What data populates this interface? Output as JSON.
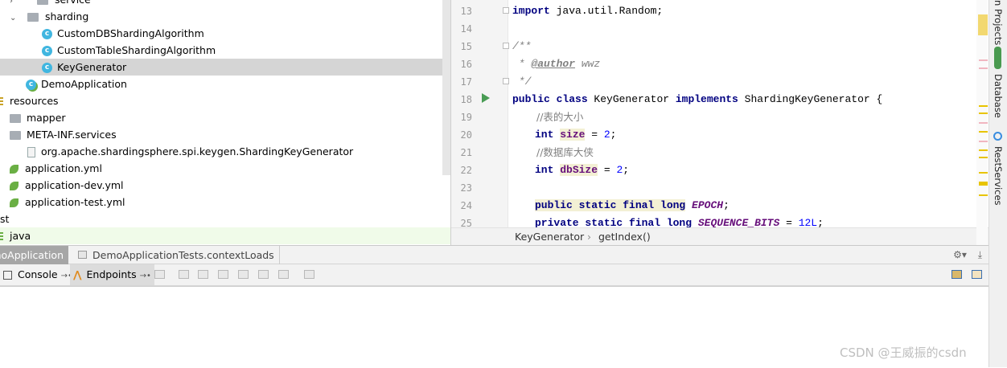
{
  "project_tree": {
    "items": [
      {
        "label": "service",
        "icon": "folder-icon"
      },
      {
        "label": "sharding",
        "icon": "folder-icon"
      },
      {
        "label": "CustomDBShardingAlgorithm",
        "icon": "class-icon"
      },
      {
        "label": "CustomTableShardingAlgorithm",
        "icon": "class-icon"
      },
      {
        "label": "KeyGenerator",
        "icon": "class-icon"
      },
      {
        "label": "DemoApplication",
        "icon": "spring-class-icon"
      },
      {
        "label": "resources",
        "icon": "resources-folder-icon"
      },
      {
        "label": "mapper",
        "icon": "folder-icon"
      },
      {
        "label": "META-INF.services",
        "icon": "folder-icon"
      },
      {
        "label": "org.apache.shardingsphere.spi.keygen.ShardingKeyGenerator",
        "icon": "file-icon"
      },
      {
        "label": "application.yml",
        "icon": "spring-yml-icon"
      },
      {
        "label": "application-dev.yml",
        "icon": "spring-yml-icon"
      },
      {
        "label": "application-test.yml",
        "icon": "spring-yml-icon"
      },
      {
        "label": "st",
        "icon": ""
      },
      {
        "label": "java",
        "icon": "test-folder-icon"
      }
    ]
  },
  "editor": {
    "line_numbers": [
      "13",
      "14",
      "15",
      "16",
      "17",
      "18",
      "19",
      "20",
      "21",
      "22",
      "23",
      "24",
      "25"
    ],
    "code": {
      "l13_kw": "import",
      "l13_rest": " java.util.Random;",
      "l15": "/**",
      "l16_star": " * ",
      "l16_tag": "@author",
      "l16_rest": " wwz",
      "l17": " */",
      "l18_kw1": "public class",
      "l18_mid": " KeyGenerator ",
      "l18_kw2": "implements",
      "l18_rest": " ShardingKeyGenerator {",
      "l19": "//表的大小",
      "l20_kw": "int",
      "l20_field": "size",
      "l20_eq": " = ",
      "l20_num": "2",
      "l20_end": ";",
      "l21": "//数据库大侠",
      "l22_kw": "int",
      "l22_field": "dbSize",
      "l22_eq": " = ",
      "l22_num": "2",
      "l22_end": ";",
      "l24_kw": "public static final long",
      "l24_field": "EPOCH",
      "l24_end": ";",
      "l25_kw": "private static final long",
      "l25_field": "SEQUENCE_BITS",
      "l25_eq": " = ",
      "l25_num": "12L",
      "l25_end": ";"
    }
  },
  "breadcrumb": {
    "class": "KeyGenerator",
    "separator": "›",
    "method": "getIndex()"
  },
  "right_bar": {
    "items": [
      "n Projects",
      "Database",
      "RestServices"
    ]
  },
  "bottom": {
    "run_tabs": [
      "DemoApplication",
      "DemoApplicationTests.contextLoads"
    ],
    "sub_tabs": [
      "Console",
      "Endpoints"
    ]
  },
  "watermark": "CSDN @王威振的csdn"
}
